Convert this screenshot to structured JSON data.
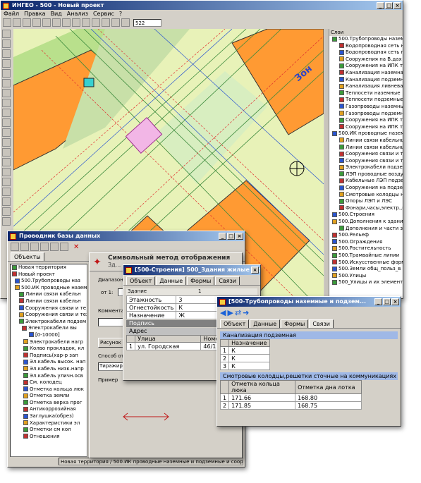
{
  "main": {
    "title": "ИНГЕО - 500 - Новый проект",
    "menu": [
      "Файл",
      "Правка",
      "Вид",
      "Анализ",
      "Сервис",
      "?"
    ],
    "scale": "522"
  },
  "map": {
    "label_zone": "Зон"
  },
  "layers": {
    "title": "Слои",
    "items": [
      "500.Трубопроводы наземные",
      "Водопроводная сеть наз",
      "Водопроводная сеть под",
      "Сооружения на В.дах",
      "Сооружения на ИПК труб",
      "Канализация наземная",
      "Канализация подземная",
      "Канализация ливневая",
      "Теплосети наземные",
      "Теплосети подземные",
      "Газопроводы наземные",
      "Газопроводы подземные",
      "Сооружения на ИПК труб",
      "Сооружения на ИПК труб",
      "500.ИК проводные наземные",
      "Линии связи кабельные",
      "Линии связи кабельные",
      "Сооружения связи и техн",
      "Сооружения связи и техн",
      "Электрокабели подземные",
      "ЛЭП проводные воздушные",
      "Кабельные ЛЭП подземны",
      "Сооружения на подземны",
      "Смотровые колодцы на к",
      "Опоры ЛЭП и ЛЭС",
      "Фонари,часы,электр.,пр",
      "500.Строения",
      "500.Дополнения к зданиям,",
      "Дополнения и части зда",
      "500.Рельеф",
      "500.Ограждения",
      "500.Растительность",
      "500.Трамвайные линии",
      "500.Искусственные формы р",
      "500.Земли общ_польз_в зас",
      "500.Улицы",
      "500_Улицы и их элементы"
    ]
  },
  "db": {
    "title": "Проводник базы данных",
    "tab": "Объекты",
    "tree": [
      "Новая территория",
      "Новый проект",
      "500.Трубопроводы наз",
      "500.ИК проводные наземные",
      "Линии связи кабельн",
      "Линии связи кабельн",
      "Сооружения связи и те",
      "Сооружения связи и тех",
      "Электрокабели подзем",
      "Электрокабели вы",
      "[0-10000]",
      "Электрокабели нагр",
      "Колво прокладок, кл",
      "Подпись(хар-р зап",
      "Эл.кабель высок. нап",
      "Эл.кабель низк.напр",
      "Эл.кабель уличн.осв",
      "См. колодец",
      "Отметка кольца люк",
      "Отметка земли",
      "Отметка верха прог",
      "Антикоррозийная",
      "Заглушка(обрез)",
      "Характеристики эл",
      "Отметки см кол",
      "Отношения"
    ],
    "status": "Новая территория / 500.ИК проводные наземные и подземные и соору"
  },
  "symbol": {
    "title": "Символьный метод отображения",
    "sub": "Зд...",
    "diapazon": "Диапазон",
    "ot": "от 1:",
    "comment": "Комментар",
    "draw": "Рисунок",
    "method": "Способ от",
    "method_val": "Тиражиро",
    "example": "Пример"
  },
  "bldg": {
    "title": "[500-Строения] 500_Здания жилые и общественные",
    "tabs": [
      "Объект",
      "Данные",
      "Формы",
      "Связи"
    ],
    "section": "Здание",
    "col_num": "1",
    "rows": [
      [
        "Этажность",
        "3"
      ],
      [
        "Огнестойкость",
        "К"
      ],
      [
        "Назначение",
        "Ж"
      ]
    ],
    "sub1": "Подпись",
    "sub2": "Адрес",
    "addr_head": [
      "Улица",
      "Номер дома"
    ],
    "addr_row": [
      "1",
      "ул. Городская",
      "46/1"
    ]
  },
  "pipe": {
    "title": "[500-Трубопроводы наземные и подзем...",
    "tabs": [
      "Объект",
      "Данные",
      "Формы",
      "Связи"
    ],
    "band1": "Канализация подземная",
    "head1": "Назначение",
    "rows1": [
      [
        "1",
        "К"
      ],
      [
        "2",
        "К"
      ],
      [
        "3",
        "К"
      ]
    ],
    "band2": "Смотровые колодцы,решетки сточные на коммуникациях",
    "head2": [
      "Отметка кольца люка",
      "Отметка дна лотка"
    ],
    "rows2": [
      [
        "1",
        "171.66",
        "168.80"
      ],
      [
        "2",
        "171.85",
        "168.75"
      ]
    ]
  }
}
